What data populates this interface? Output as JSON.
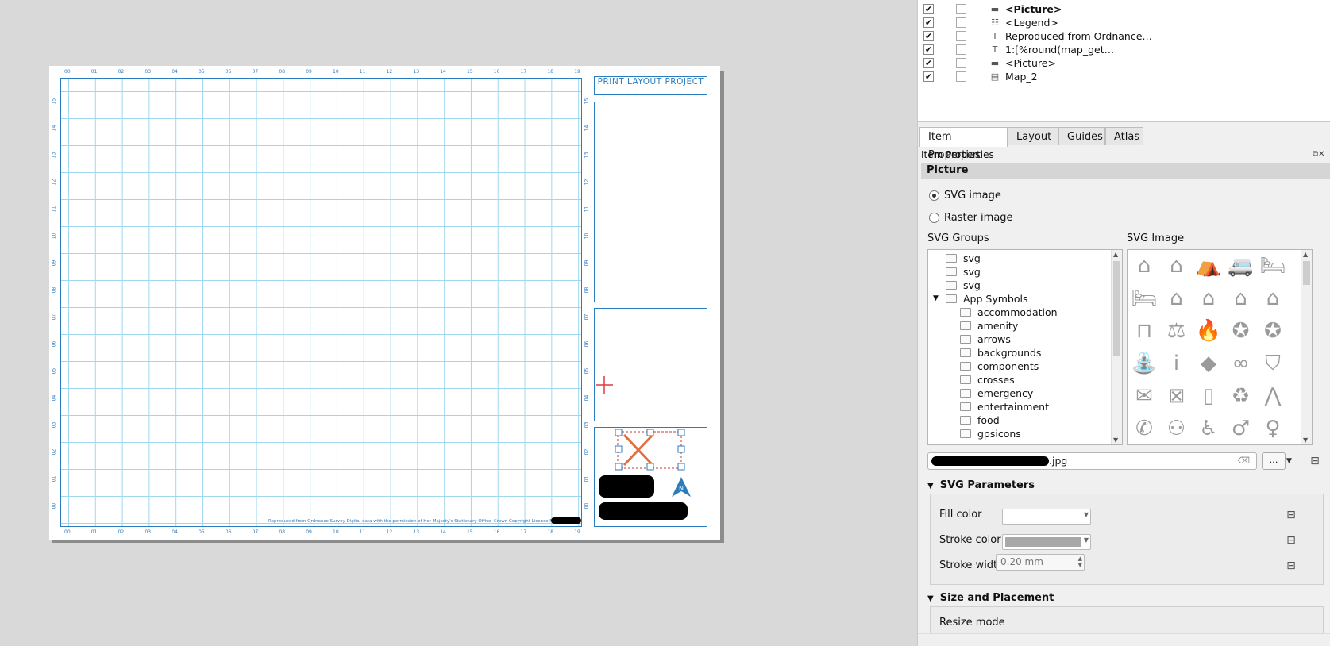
{
  "layout": {
    "title": "PRINT LAYOUT PROJECT",
    "credit_text": "Reproduced from Ordnance Survey Digital data with the permission of Her Majesty's Stationary Office. Crown Copyright Licence No. A",
    "grid_x_labels": [
      "00",
      "01",
      "02",
      "03",
      "04",
      "05",
      "06",
      "07",
      "08",
      "09",
      "10",
      "11",
      "12",
      "13",
      "14",
      "15",
      "16",
      "17",
      "18",
      "19"
    ],
    "grid_y_labels": [
      "15",
      "14",
      "13",
      "12",
      "11",
      "10",
      "09",
      "08",
      "07",
      "06",
      "05",
      "04",
      "03",
      "02",
      "01",
      "00"
    ],
    "north_arrow_label": "N"
  },
  "layers_panel": {
    "items": [
      {
        "label": "<Picture>",
        "icon": "picture-icon",
        "bold": true,
        "visible": true
      },
      {
        "label": "<Legend>",
        "icon": "legend-icon",
        "bold": false,
        "visible": true
      },
      {
        "label": "Reproduced from Ordnance…",
        "icon": "text-label-icon",
        "bold": false,
        "visible": true
      },
      {
        "label": "1:[%round(map_get…",
        "icon": "text-label-icon",
        "bold": false,
        "visible": true
      },
      {
        "label": "<Picture>",
        "icon": "picture-icon",
        "bold": false,
        "visible": true
      },
      {
        "label": "Map_2",
        "icon": "map-icon",
        "bold": false,
        "visible": true
      }
    ]
  },
  "tabs": [
    "Item Properties",
    "Layout",
    "Guides",
    "Atlas"
  ],
  "item_properties": {
    "header": "Item Properties",
    "section": "Picture",
    "radio_svg": "SVG image",
    "radio_raster": "Raster image",
    "svg_groups_label": "SVG Groups",
    "svg_image_label": "SVG Image",
    "tree": [
      {
        "label": "svg",
        "level": 0
      },
      {
        "label": "svg",
        "level": 0
      },
      {
        "label": "svg",
        "level": 0
      },
      {
        "label": "App Symbols",
        "level": 0,
        "expanded": true
      },
      {
        "label": "accommodation",
        "level": 1
      },
      {
        "label": "amenity",
        "level": 1
      },
      {
        "label": "arrows",
        "level": 1
      },
      {
        "label": "backgrounds",
        "level": 1
      },
      {
        "label": "components",
        "level": 1
      },
      {
        "label": "crosses",
        "level": 1
      },
      {
        "label": "emergency",
        "level": 1
      },
      {
        "label": "entertainment",
        "level": 1
      },
      {
        "label": "food",
        "level": 1
      },
      {
        "label": "gpsicons",
        "level": 1
      }
    ],
    "svg_icons": [
      "shelter-icon",
      "bed-and-breakfast-icon",
      "tent-icon",
      "caravan-icon",
      "hostel-icon",
      "bed-icon",
      "house-icon",
      "shelter-rain-icon",
      "shelter-rain-icon",
      "chalet-icon",
      "bench-icon",
      "scales-icon",
      "fire-icon",
      "fire-station-icon",
      "fire-station-icon",
      "fountain-icon",
      "information-icon",
      "book-icon",
      "handcuffs-icon",
      "police-icon",
      "envelope-icon",
      "post-office-icon",
      "phone-box-icon",
      "recycling-icon",
      "easel-icon",
      "telephone-icon",
      "toilets-icon",
      "wheelchair-wc-icon",
      "male-wc-icon",
      "female-wc-icon"
    ],
    "path_suffix": ".jpg",
    "browse_label": "…",
    "svg_parameters": "SVG Parameters",
    "fill_color_label": "Fill color",
    "stroke_color_label": "Stroke color",
    "stroke_width_label": "Stroke width",
    "stroke_width_value": "0.20 mm",
    "fill_color": "#ffffff",
    "stroke_color": "#a8a8a8",
    "size_and_placement": "Size and Placement",
    "resize_mode_label": "Resize mode"
  },
  "colors": {
    "accent": "#2b7bbf",
    "grid": "#9fd7ef",
    "cursor": "#e0393e"
  }
}
